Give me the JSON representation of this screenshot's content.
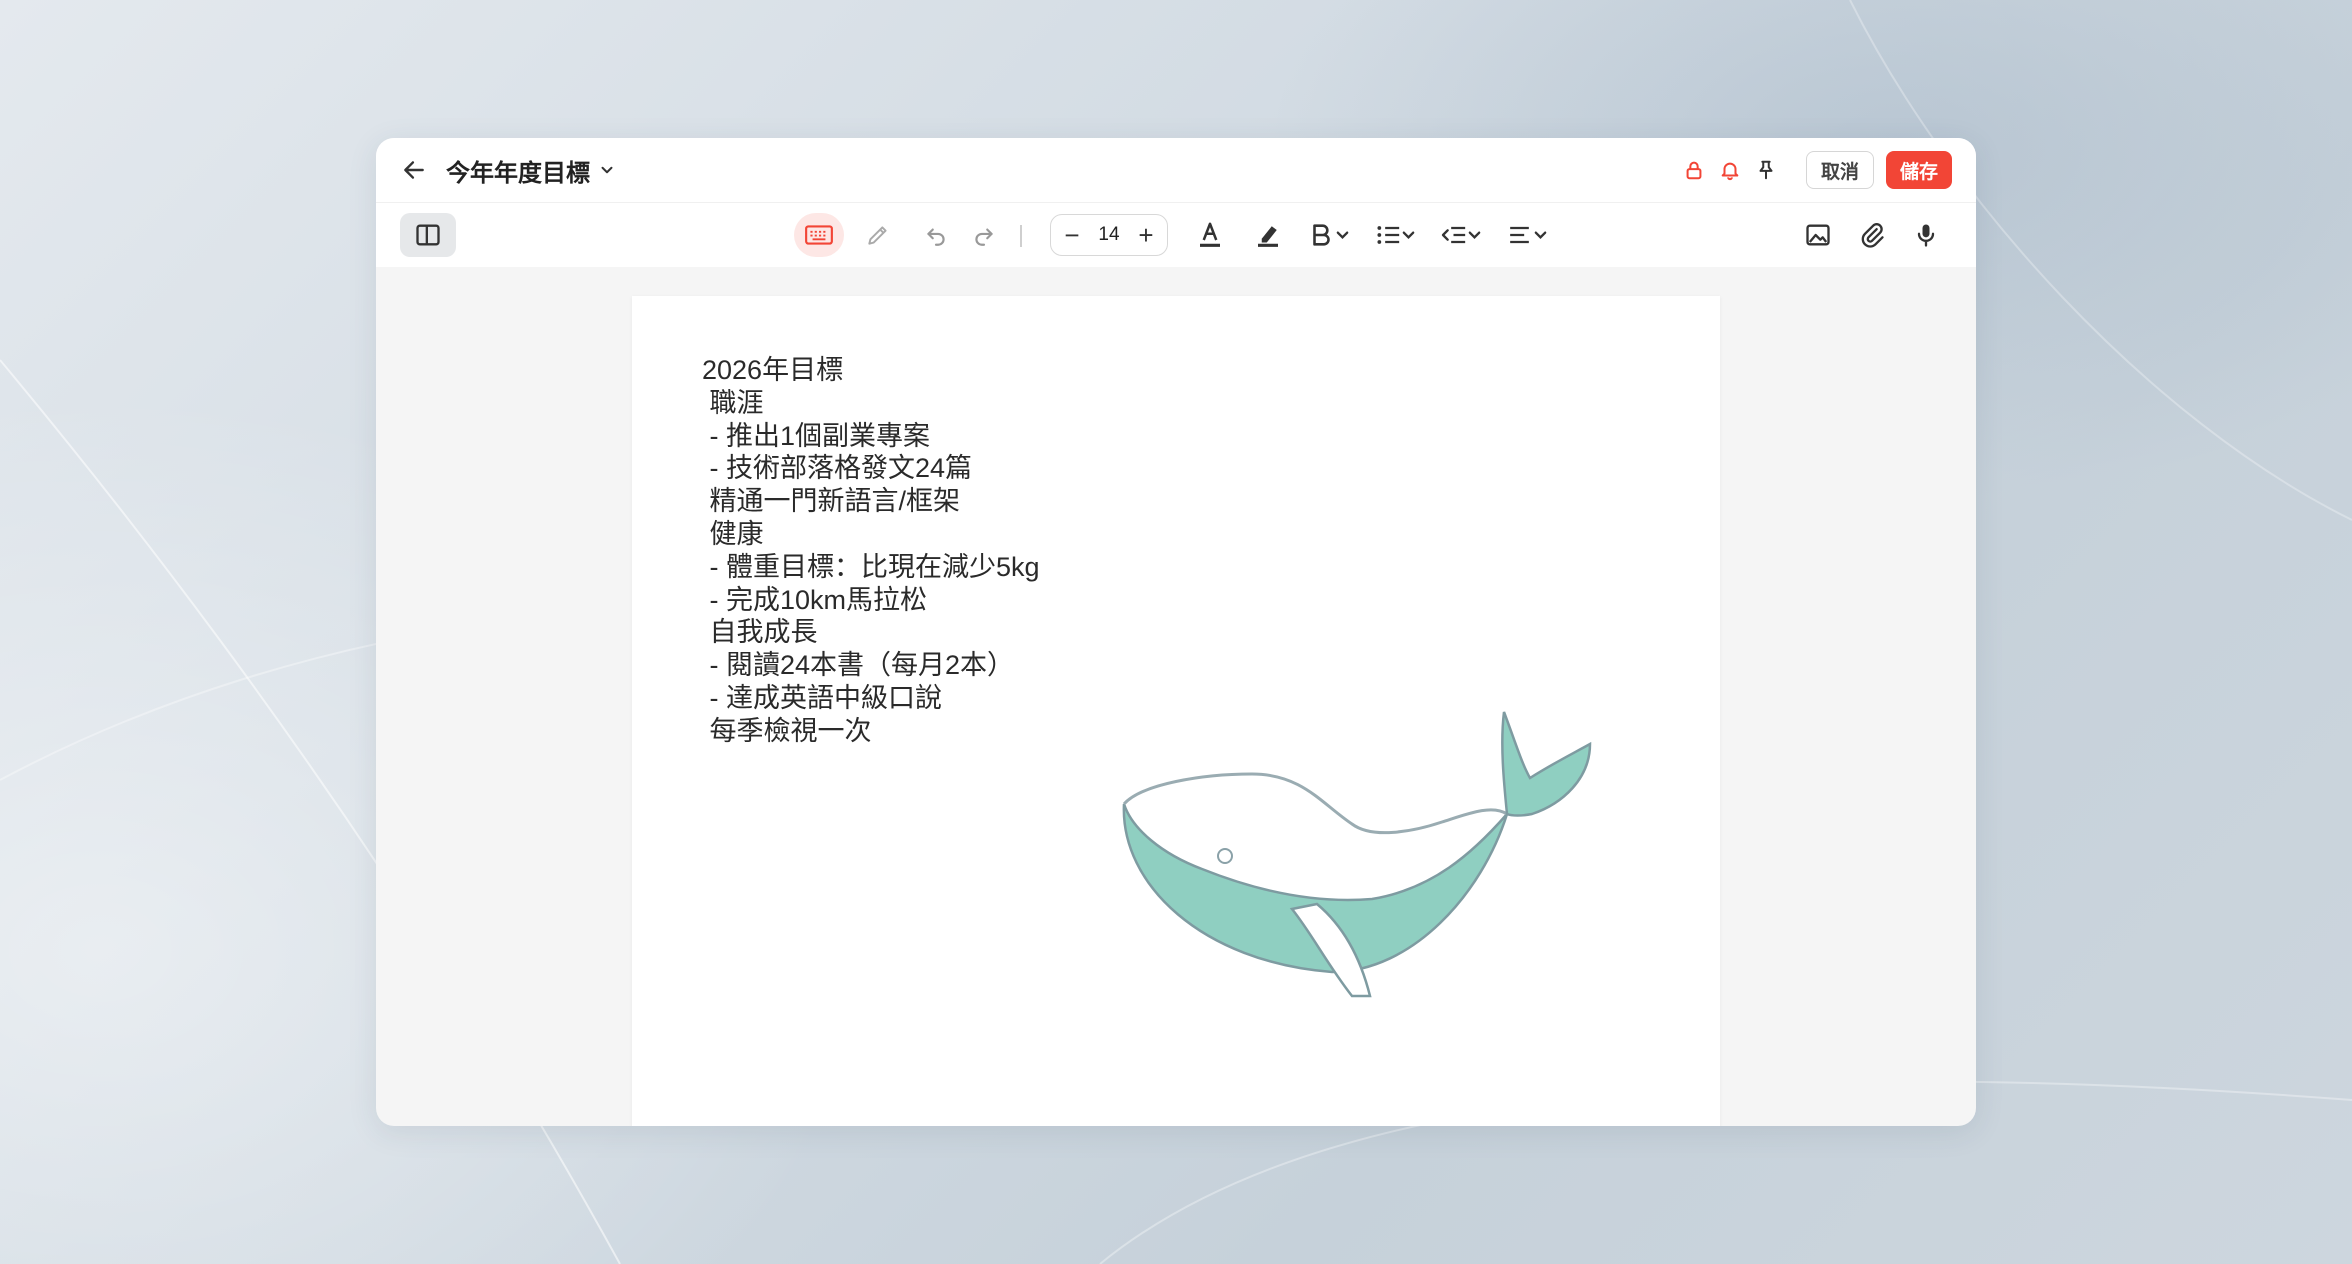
{
  "document": {
    "title": "今年年度目標"
  },
  "actions": {
    "cancel_label": "取消",
    "save_label": "儲存"
  },
  "title_icons": [
    "lock-icon",
    "bell-icon",
    "pin-icon"
  ],
  "toolbar": {
    "font_size": "14",
    "decrease_label": "−",
    "increase_label": "+",
    "icons": [
      "sidebar-toggle-icon",
      "keyboard-icon",
      "pencil-icon",
      "undo-icon",
      "redo-icon",
      "text-color-icon",
      "highlighter-icon",
      "bold-icon",
      "bullet-list-icon",
      "indent-icon",
      "align-icon",
      "image-icon",
      "paperclip-icon",
      "microphone-icon"
    ]
  },
  "colors": {
    "accent": "#f24536",
    "whale_fill": "#8fcfc1",
    "whale_outline": "#8aa1a8"
  },
  "note_lines": [
    "2026年目標",
    " 職涯",
    " - 推出1個副業專案",
    " - 技術部落格發文24篇",
    " 精通一門新語言/框架",
    " 健康",
    " - 體重目標：比現在減少5kg",
    " - 完成10km馬拉松",
    " 自我成長",
    " - 閱讀24本書（每月2本）",
    " - 達成英語中級口說",
    " 每季檢視一次"
  ],
  "drawing": {
    "subject": "whale-sketch"
  }
}
